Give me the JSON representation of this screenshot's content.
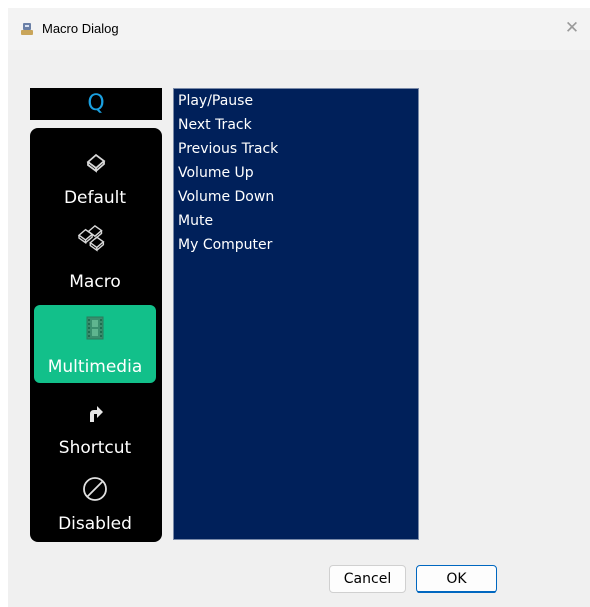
{
  "window": {
    "title": "Macro Dialog",
    "close_glyph": "✕",
    "icon": "app-icon"
  },
  "key": {
    "label": "Q",
    "color": "#1aa0e0"
  },
  "modes": [
    {
      "label": "Default",
      "icon": "keycap-icon",
      "active": false
    },
    {
      "label": "Macro",
      "icon": "multi-keycap-icon",
      "active": false
    },
    {
      "label": "Multimedia",
      "icon": "film-strip-icon",
      "active": true
    },
    {
      "label": "Shortcut",
      "icon": "shortcut-arrow-icon",
      "active": false
    },
    {
      "label": "Disabled",
      "icon": "disabled-circle-icon",
      "active": false
    }
  ],
  "list": {
    "items": [
      "Play/Pause",
      "Next Track",
      "Previous Track",
      "Volume Up",
      "Volume Down",
      "Mute",
      "My Computer"
    ]
  },
  "buttons": {
    "cancel": "Cancel",
    "ok": "OK"
  },
  "colors": {
    "accent": "#12c08a",
    "list_bg": "#00205a",
    "panel_bg": "#000000",
    "ok_border": "#0067c0"
  }
}
